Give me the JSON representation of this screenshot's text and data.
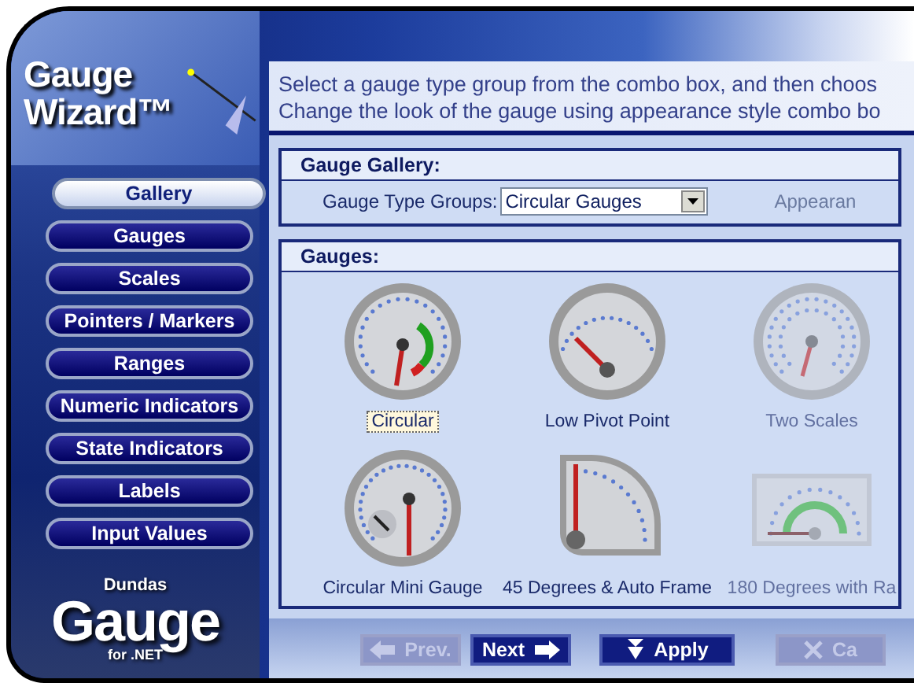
{
  "wizard": {
    "title_lines": [
      "Gauge",
      "Wizard™"
    ]
  },
  "nav": [
    {
      "label": "Gallery",
      "selected": true
    },
    {
      "label": "Gauges",
      "selected": false
    },
    {
      "label": "Scales",
      "selected": false
    },
    {
      "label": "Pointers / Markers",
      "selected": false
    },
    {
      "label": "Ranges",
      "selected": false
    },
    {
      "label": "Numeric Indicators",
      "selected": false
    },
    {
      "label": "State Indicators",
      "selected": false
    },
    {
      "label": "Labels",
      "selected": false
    },
    {
      "label": "Input Values",
      "selected": false
    }
  ],
  "logo": {
    "brand": "Dundas",
    "product": "Gauge",
    "platform": "for .NET"
  },
  "instructions": [
    "Select a gauge type group from the combo box, and then choos",
    "Change the look of the gauge using appearance style combo bo"
  ],
  "gallery": {
    "title": "Gauge Gallery:",
    "type_label": "Gauge Type Groups:",
    "type_value": "Circular Gauges",
    "appearance_label": "Appearan"
  },
  "gauges": {
    "title": "Gauges:",
    "items": [
      {
        "label": "Circular",
        "kind": "circular",
        "selected": true
      },
      {
        "label": "Low Pivot Point",
        "kind": "lowpivot",
        "selected": false
      },
      {
        "label": "Two Scales",
        "kind": "twoscales",
        "selected": false
      },
      {
        "label": "Circular Mini Gauge",
        "kind": "mini",
        "selected": false
      },
      {
        "label": "45 Degrees & Auto Frame",
        "kind": "quarter",
        "selected": false
      },
      {
        "label": "180 Degrees with Ra",
        "kind": "half",
        "selected": false
      }
    ]
  },
  "buttons": [
    {
      "label": "Prev.",
      "kind": "prev",
      "disabled": true
    },
    {
      "label": "Next",
      "kind": "next",
      "disabled": false
    },
    {
      "label": "Apply",
      "kind": "apply",
      "disabled": false
    },
    {
      "label": "Ca",
      "kind": "cancel",
      "disabled": true
    }
  ]
}
